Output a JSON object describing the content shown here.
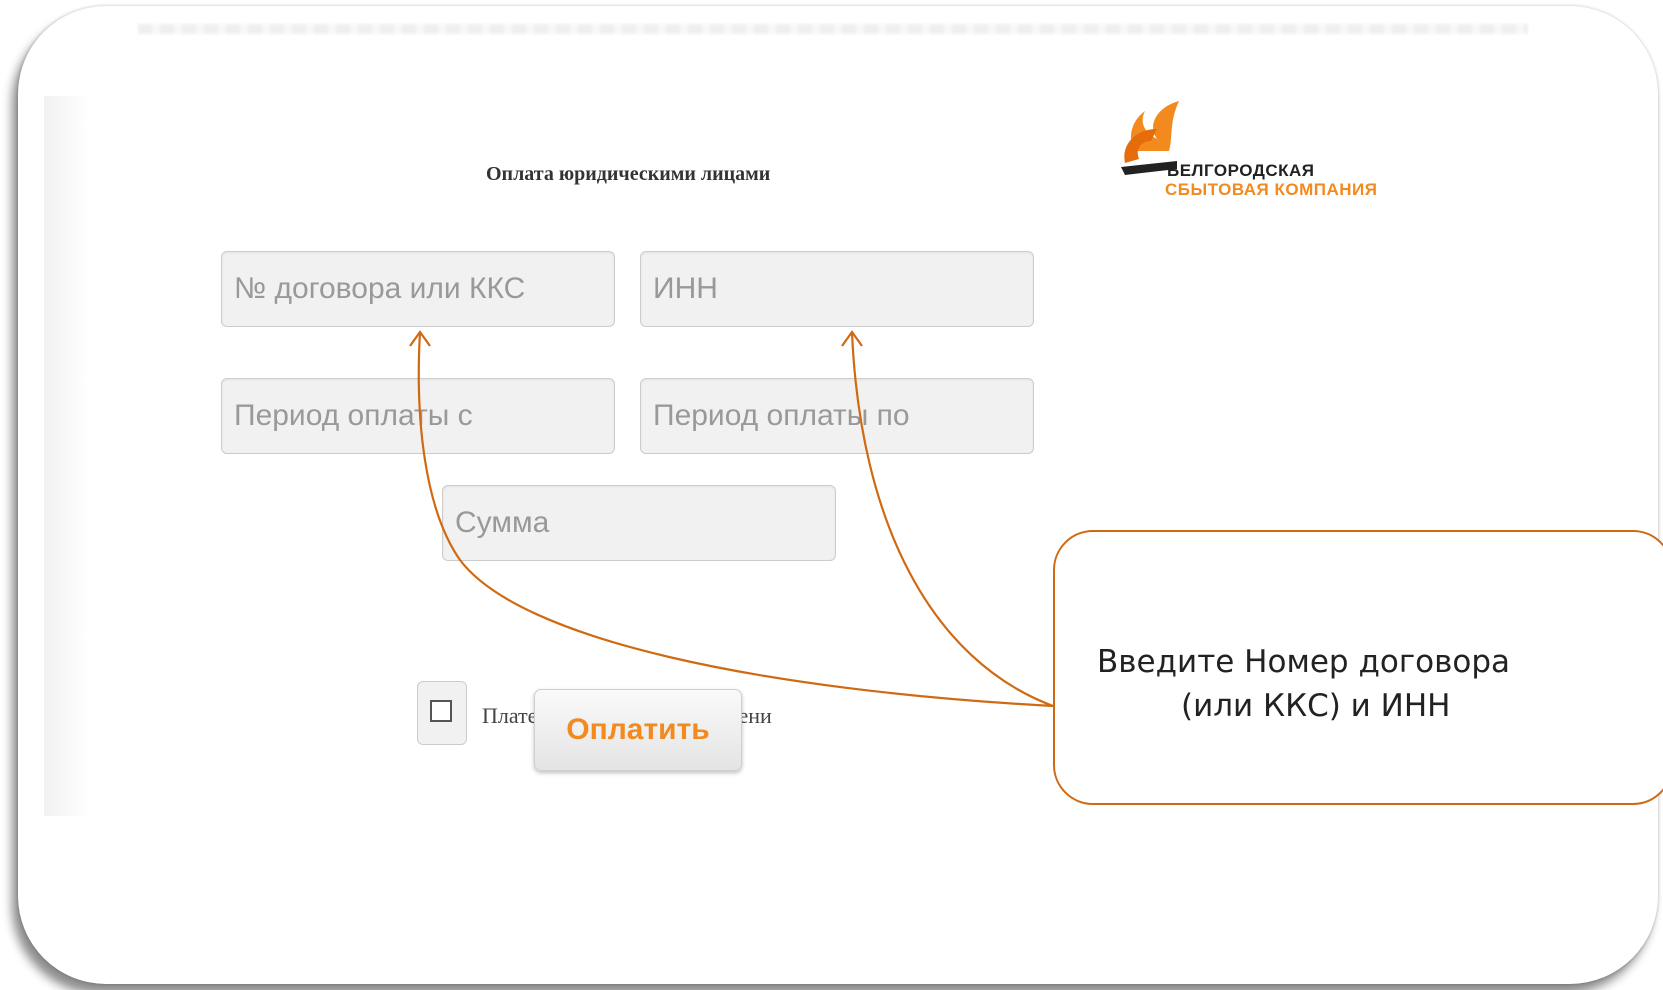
{
  "page_title": "Оплата юридическими лицами",
  "logo": {
    "line1": "БЕЛГОРОДСКАЯ",
    "line2": "СБЫТОВАЯ КОМПАНИЯ",
    "icon": "company-logo-icon"
  },
  "form": {
    "contract_placeholder": "№ договора или ККС",
    "inn_placeholder": "ИНН",
    "period_from_placeholder": "Период оплаты с",
    "period_to_placeholder": "Период оплаты по",
    "sum_placeholder": "Сумма",
    "penalty_checkbox_label": "Платеж в счет погашения пени",
    "penalty_checked": false,
    "submit_label": "Оплатить"
  },
  "callout": {
    "line1": "Введите Номер договора",
    "line2": "(или ККС) и ИНН"
  },
  "colors": {
    "accent": "#f28a1e",
    "callout_border": "#d06a12",
    "field_bg": "#f1f1f1",
    "placeholder": "#999999"
  }
}
